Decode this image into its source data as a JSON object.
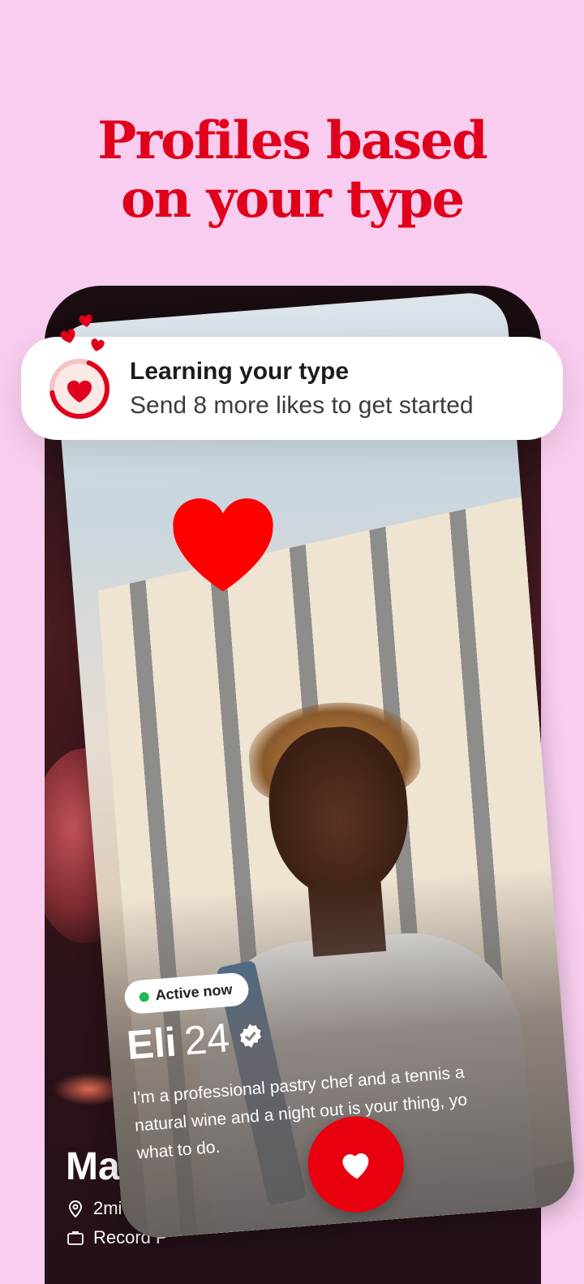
{
  "headline": {
    "line1": "Profiles based",
    "line2": "on your type"
  },
  "notification": {
    "title": "Learning your type",
    "subtitle": "Send 8 more likes to get started",
    "icon": "heart-progress-icon"
  },
  "back_profile": {
    "name": "Matt",
    "distance": "2mi",
    "job": "Record P"
  },
  "front_profile": {
    "status": "Active now",
    "name": "Eli",
    "age": "24",
    "bio_lines": [
      "I'm a professional pastry chef and a tennis a",
      "natural wine and a night out is your thing, yo",
      "what to do."
    ]
  },
  "colors": {
    "background": "#f9cdef",
    "accent": "#e0001b",
    "like_button": "#e8000f",
    "active_dot": "#1db954"
  }
}
